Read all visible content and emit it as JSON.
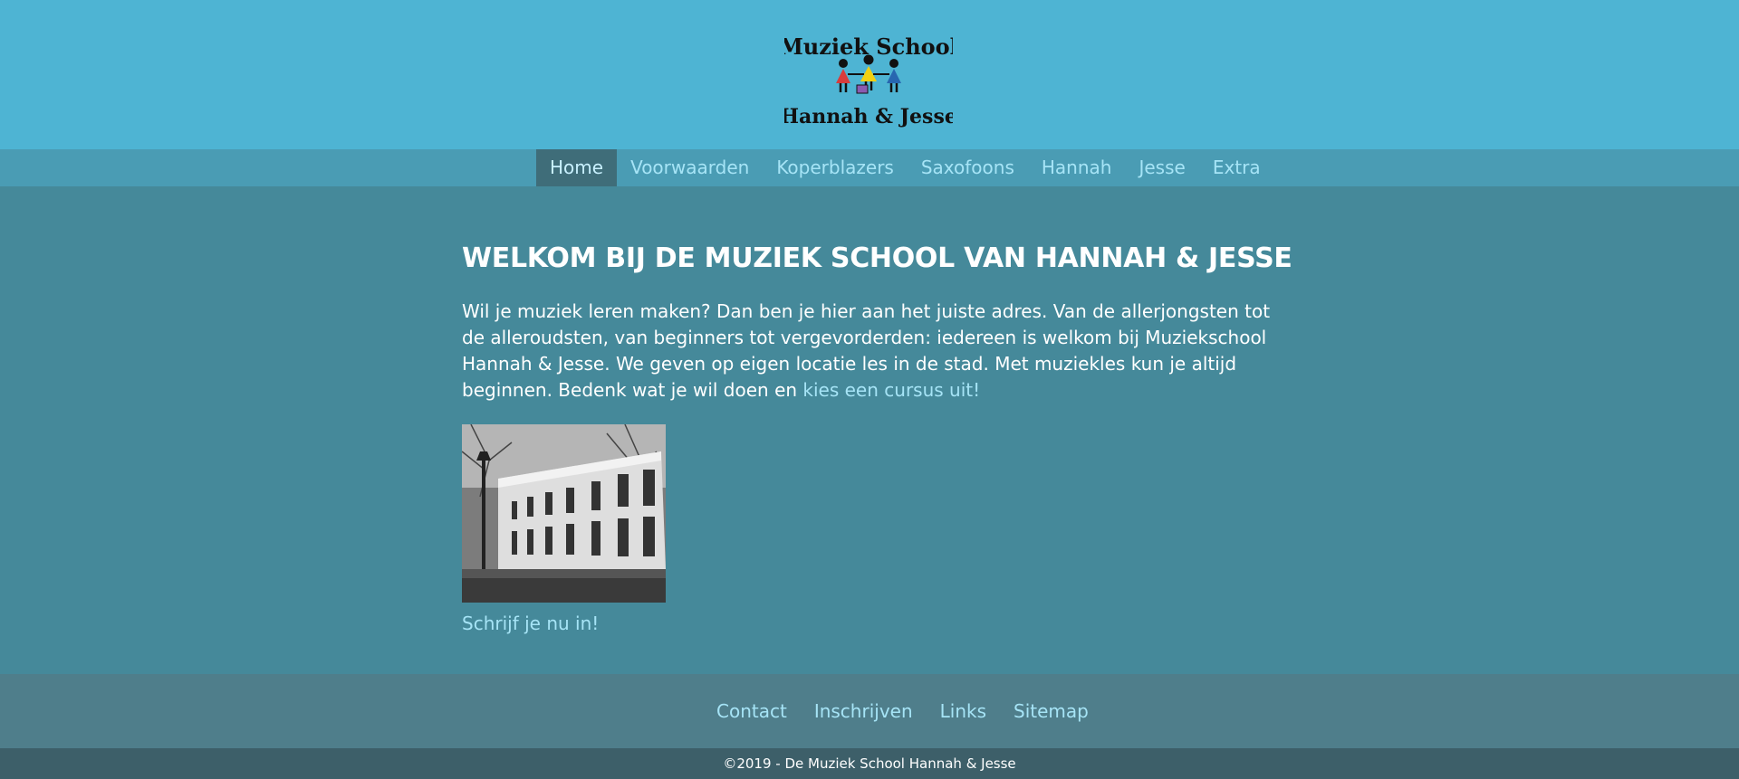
{
  "colors": {
    "header_bg": "#4eb4d3",
    "nav_bg": "#4a9cb4",
    "nav_active_bg": "#3f6d79",
    "main_bg": "#45899a",
    "footer_bg": "#4f7e8b",
    "bottom_bar_bg": "#3d5f69",
    "link": "#a6e4f6",
    "text": "#ffffff"
  },
  "header": {
    "logo": {
      "line1": "Muziek School",
      "line2": "Hannah & Jesse",
      "figures": [
        "red",
        "yellow",
        "blue"
      ]
    }
  },
  "nav": {
    "items": [
      {
        "label": "Home",
        "active": true
      },
      {
        "label": "Voorwaarden",
        "active": false
      },
      {
        "label": "Koperblazers",
        "active": false
      },
      {
        "label": "Saxofoons",
        "active": false
      },
      {
        "label": "Hannah",
        "active": false
      },
      {
        "label": "Jesse",
        "active": false
      },
      {
        "label": "Extra",
        "active": false
      }
    ]
  },
  "main": {
    "title": "WELKOM BIJ DE MUZIEK SCHOOL VAN HANNAH & JESSE",
    "intro_text": "Wil je muziek leren maken? Dan ben je hier aan het juiste adres. Van de allerjongsten tot de alleroudsten, van beginners tot vergevorderden: iedereen is welkom bij Muziekschool Hannah & Jesse. We geven op eigen locatie les in de stad. Met muziekles kun je altijd beginnen. Bedenk wat je wil doen en ",
    "intro_link": "kies een cursus uit!",
    "image": {
      "style": "black-and-white photo of a building"
    },
    "signup_link": "Schrijf je nu in!"
  },
  "footer": {
    "links": [
      "Contact",
      "Inschrijven",
      "Links",
      "Sitemap"
    ]
  },
  "bottom_bar": {
    "copyright": "©2019 - De Muziek School Hannah & Jesse"
  }
}
